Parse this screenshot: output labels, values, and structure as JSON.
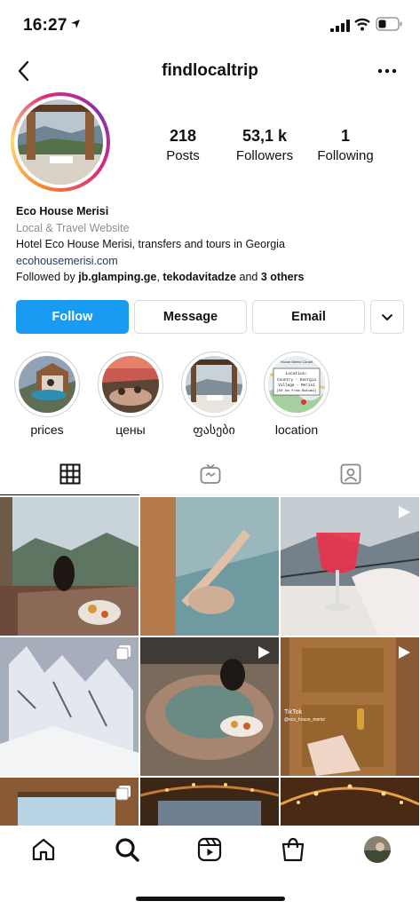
{
  "status_bar": {
    "time": "16:27"
  },
  "header": {
    "username": "findlocaltrip"
  },
  "stats": [
    {
      "number": "218",
      "label": "Posts"
    },
    {
      "number": "53,1 k",
      "label": "Followers"
    },
    {
      "number": "1",
      "label": "Following"
    }
  ],
  "bio": {
    "name": "Eco House Merisi",
    "category": "Local & Travel Website",
    "description": "Hotel Eco House Merisi, transfers and tours in Georgia",
    "link": "ecohousemerisi.com",
    "followed_prefix": "Followed by ",
    "followed_user1": "jb.glamping.ge",
    "followed_sep": ", ",
    "followed_user2": "tekodavitadze",
    "followed_and": " and ",
    "followed_others": "3 others"
  },
  "actions": {
    "follow": "Follow",
    "message": "Message",
    "email": "Email"
  },
  "highlights": [
    {
      "label": "prices"
    },
    {
      "label": "цены"
    },
    {
      "label": "ფასები"
    },
    {
      "label": "location"
    }
  ],
  "location_card": {
    "line1": "Location:",
    "line2": "Country - Georgia",
    "line3": "Village - Merisi",
    "line4": "(50 km from Batumi)",
    "top": "House Merisi Салиб"
  },
  "tiktok": {
    "label": "TikTok",
    "handle": "@eco_house_merisi"
  },
  "colors": {
    "primary": "#1a9bf3",
    "link": "#1e3b6b",
    "muted": "#8e8e8e"
  }
}
